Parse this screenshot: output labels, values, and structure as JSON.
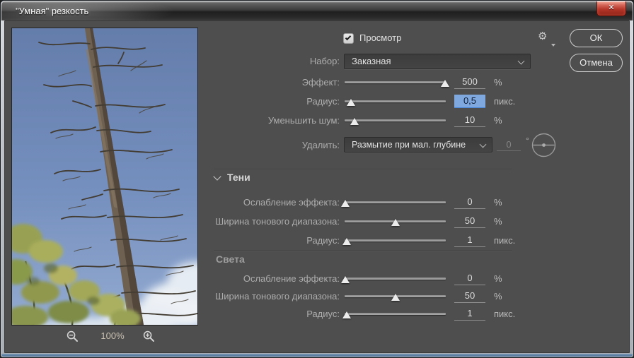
{
  "window": {
    "title": "\"Умная\" резкость",
    "close_glyph": "✕"
  },
  "header": {
    "preview_label": "Просмотр",
    "preview_checked": true,
    "gear_glyph": "⚙",
    "ok_label": "ОК",
    "cancel_label": "Отмена"
  },
  "preset": {
    "label": "Набор:",
    "value": "Заказная"
  },
  "main": {
    "effect": {
      "label": "Эффект:",
      "value": "500",
      "unit": "%",
      "slider_percent": 99
    },
    "radius": {
      "label": "Радиус:",
      "value": "0,5",
      "unit": "пикс.",
      "slider_percent": 6,
      "value_selected": true
    },
    "noise": {
      "label": "Уменьшить шум:",
      "value": "10",
      "unit": "%",
      "slider_percent": 10
    },
    "remove": {
      "label": "Удалить:",
      "value": "Размытие при мал. глубине",
      "angle_value": "0",
      "angle_unit": "°"
    }
  },
  "shadows": {
    "title": "Тени",
    "fade": {
      "label": "Ослабление эффекта:",
      "value": "0",
      "unit": "%",
      "slider_percent": 1
    },
    "tonal": {
      "label": "Ширина тонового диапазона:",
      "value": "50",
      "unit": "%",
      "slider_percent": 50
    },
    "radius": {
      "label": "Радиус:",
      "value": "1",
      "unit": "пикс.",
      "slider_percent": 2
    }
  },
  "highlights": {
    "title": "Света",
    "fade": {
      "label": "Ослабление эффекта:",
      "value": "0",
      "unit": "%",
      "slider_percent": 1
    },
    "tonal": {
      "label": "Ширина тонового диапазона:",
      "value": "50",
      "unit": "%",
      "slider_percent": 50
    },
    "radius": {
      "label": "Радиус:",
      "value": "1",
      "unit": "пикс.",
      "slider_percent": 2
    }
  },
  "preview": {
    "zoom_level": "100%"
  }
}
